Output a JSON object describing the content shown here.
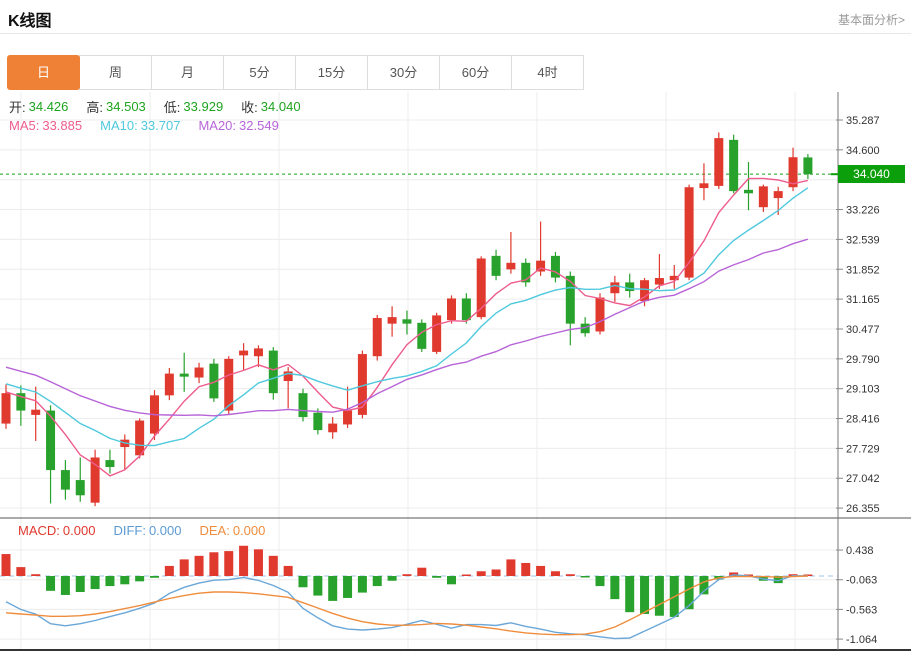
{
  "header": {
    "title": "K线图",
    "link": "基本面分析>"
  },
  "tabs": {
    "items": [
      "日",
      "周",
      "月",
      "5分",
      "15分",
      "30分",
      "60分",
      "4时"
    ],
    "active_index": 0
  },
  "legend": {
    "label_color": "#333333",
    "ohlc_value_color": "#1fa41f",
    "ohlc": [
      {
        "label": "开:",
        "value": "34.426"
      },
      {
        "label": "高:",
        "value": "34.503"
      },
      {
        "label": "低:",
        "value": "33.929"
      },
      {
        "label": "收:",
        "value": "34.040"
      }
    ],
    "ma": [
      {
        "label": "MA5:",
        "value": "33.885",
        "color": "#ee5c8d"
      },
      {
        "label": "MA10:",
        "value": "33.707",
        "color": "#4ec9dd"
      },
      {
        "label": "MA20:",
        "value": "32.549",
        "color": "#b764d8"
      }
    ],
    "macd": [
      {
        "label": "MACD:",
        "value": "0.000",
        "color": "#e0392e"
      },
      {
        "label": "DIFF:",
        "value": "0.000",
        "color": "#5b9bd5"
      },
      {
        "label": "DEA:",
        "value": "0.000",
        "color": "#f08c3c"
      }
    ]
  },
  "price_tag": {
    "text": "34.040",
    "bg": "#0c9f0c"
  },
  "chart_data": {
    "type": "candlestick+macd",
    "colors": {
      "up": "#e0392e",
      "down": "#28a22c",
      "ma5": "#ee5c8d",
      "ma10": "#4ec9dd",
      "ma20": "#b764d8",
      "diff_line": "#6aa7d8",
      "dea_line": "#ef8d3d",
      "current_price_line": "#19a019",
      "macd_zero_line": "#9fc3e8",
      "grid": "#ececec",
      "axis": "#777777"
    },
    "main": {
      "current_price": 34.04,
      "y_axis": [
        {
          "label": "35.287",
          "value": 35.287
        },
        {
          "label": "34.600",
          "value": 34.6
        },
        {
          "label": "33.226",
          "value": 33.226
        },
        {
          "label": "32.539",
          "value": 32.539
        },
        {
          "label": "31.852",
          "value": 31.852
        },
        {
          "label": "31.165",
          "value": 31.165
        },
        {
          "label": "30.477",
          "value": 30.477
        },
        {
          "label": "29.790",
          "value": 29.79
        },
        {
          "label": "29.103",
          "value": 29.103
        },
        {
          "label": "28.416",
          "value": 28.416
        },
        {
          "label": "27.729",
          "value": 27.729
        },
        {
          "label": "27.042",
          "value": 27.042
        },
        {
          "label": "26.355",
          "value": 26.355
        }
      ],
      "ma_periods": [
        5,
        10,
        20
      ],
      "prehistory_closes": [
        30.6,
        30.5,
        30.4,
        30.2,
        30.0,
        29.9,
        29.95,
        29.8,
        29.7,
        29.6,
        29.75,
        29.6,
        29.5,
        29.4,
        29.3,
        29.2,
        29.15,
        29.1,
        29.0,
        28.9
      ],
      "candles": [
        [
          28.3,
          29.2,
          28.18,
          29.0
        ],
        [
          29.0,
          29.18,
          28.25,
          28.6
        ],
        [
          28.5,
          29.15,
          27.9,
          28.62
        ],
        [
          28.6,
          28.72,
          26.46,
          27.23
        ],
        [
          27.23,
          27.46,
          26.55,
          26.78
        ],
        [
          27.0,
          27.52,
          26.5,
          26.65
        ],
        [
          26.48,
          27.7,
          26.4,
          27.52
        ],
        [
          27.46,
          27.7,
          27.15,
          27.3
        ],
        [
          27.76,
          28.05,
          27.25,
          27.93
        ],
        [
          27.57,
          28.42,
          27.5,
          28.37
        ],
        [
          28.07,
          29.07,
          27.92,
          28.95
        ],
        [
          28.95,
          29.58,
          28.84,
          29.45
        ],
        [
          29.45,
          29.93,
          29.03,
          29.38
        ],
        [
          29.36,
          29.7,
          29.23,
          29.59
        ],
        [
          29.68,
          29.79,
          28.8,
          28.88
        ],
        [
          28.6,
          29.85,
          28.5,
          29.79
        ],
        [
          29.87,
          30.15,
          29.53,
          29.98
        ],
        [
          29.85,
          30.1,
          29.6,
          30.03
        ],
        [
          29.98,
          30.06,
          28.85,
          29.0
        ],
        [
          29.28,
          29.6,
          28.65,
          29.5
        ],
        [
          29.0,
          29.1,
          28.35,
          28.45
        ],
        [
          28.55,
          28.65,
          28.05,
          28.15
        ],
        [
          28.1,
          28.45,
          27.95,
          28.3
        ],
        [
          28.28,
          29.15,
          28.2,
          28.6
        ],
        [
          28.5,
          29.98,
          28.42,
          29.9
        ],
        [
          29.85,
          30.8,
          29.75,
          30.73
        ],
        [
          30.6,
          31.0,
          30.3,
          30.75
        ],
        [
          30.7,
          30.9,
          30.35,
          30.6
        ],
        [
          30.62,
          30.7,
          29.95,
          30.02
        ],
        [
          29.95,
          30.85,
          29.9,
          30.79
        ],
        [
          30.68,
          31.25,
          30.6,
          31.18
        ],
        [
          31.18,
          31.3,
          30.6,
          30.68
        ],
        [
          30.75,
          32.15,
          30.7,
          32.1
        ],
        [
          32.16,
          32.3,
          31.6,
          31.7
        ],
        [
          31.85,
          32.71,
          31.75,
          32.0
        ],
        [
          32.0,
          32.1,
          31.45,
          31.55
        ],
        [
          31.8,
          32.95,
          31.7,
          32.05
        ],
        [
          32.16,
          32.25,
          31.55,
          31.66
        ],
        [
          31.7,
          31.8,
          30.1,
          30.6
        ],
        [
          30.6,
          30.75,
          30.3,
          30.38
        ],
        [
          30.42,
          31.3,
          30.35,
          31.2
        ],
        [
          31.3,
          31.7,
          31.1,
          31.55
        ],
        [
          31.55,
          31.75,
          31.2,
          31.35
        ],
        [
          31.12,
          31.65,
          31.0,
          31.6
        ],
        [
          31.5,
          32.2,
          31.4,
          31.65
        ],
        [
          31.6,
          31.95,
          31.4,
          31.7
        ],
        [
          31.66,
          33.8,
          31.6,
          33.74
        ],
        [
          33.72,
          34.29,
          33.44,
          33.83
        ],
        [
          33.77,
          35.0,
          33.7,
          34.87
        ],
        [
          34.83,
          34.95,
          33.6,
          33.65
        ],
        [
          33.68,
          34.32,
          33.21,
          33.6
        ],
        [
          33.28,
          33.8,
          33.17,
          33.76
        ],
        [
          33.49,
          33.75,
          33.1,
          33.65
        ],
        [
          33.74,
          34.65,
          33.65,
          34.43
        ],
        [
          34.426,
          34.503,
          33.929,
          34.04
        ]
      ]
    },
    "macd": {
      "y_axis": [
        {
          "label": "0.438",
          "value": 0.438
        },
        {
          "label": "-0.063",
          "value": -0.063
        },
        {
          "label": "-0.563",
          "value": -0.563
        },
        {
          "label": "-1.064",
          "value": -1.064
        }
      ],
      "hist": [
        0.37,
        0.15,
        0.03,
        -0.25,
        -0.32,
        -0.27,
        -0.22,
        -0.17,
        -0.14,
        -0.09,
        -0.03,
        0.17,
        0.28,
        0.34,
        0.4,
        0.42,
        0.51,
        0.45,
        0.34,
        0.17,
        -0.19,
        -0.33,
        -0.42,
        -0.37,
        -0.28,
        -0.17,
        -0.08,
        0.03,
        0.14,
        -0.03,
        -0.14,
        0.02,
        0.08,
        0.11,
        0.28,
        0.22,
        0.17,
        0.08,
        0.03,
        -0.02,
        -0.17,
        -0.39,
        -0.61,
        -0.64,
        -0.67,
        -0.69,
        -0.56,
        -0.31,
        -0.06,
        0.06,
        0.02,
        -0.08,
        -0.12,
        0.03,
        0.0
      ],
      "dea": [
        -0.62,
        -0.64,
        -0.66,
        -0.68,
        -0.68,
        -0.67,
        -0.64,
        -0.6,
        -0.55,
        -0.5,
        -0.44,
        -0.38,
        -0.33,
        -0.29,
        -0.27,
        -0.27,
        -0.28,
        -0.3,
        -0.33,
        -0.36,
        -0.45,
        -0.54,
        -0.63,
        -0.71,
        -0.77,
        -0.81,
        -0.83,
        -0.83,
        -0.82,
        -0.8,
        -0.81,
        -0.83,
        -0.86,
        -0.89,
        -0.93,
        -0.96,
        -0.98,
        -0.99,
        -0.99,
        -0.98,
        -0.94,
        -0.86,
        -0.74,
        -0.61,
        -0.48,
        -0.35,
        -0.22,
        -0.1,
        -0.03,
        -0.01,
        -0.01,
        -0.01,
        -0.02,
        -0.01,
        0.0
      ]
    }
  }
}
